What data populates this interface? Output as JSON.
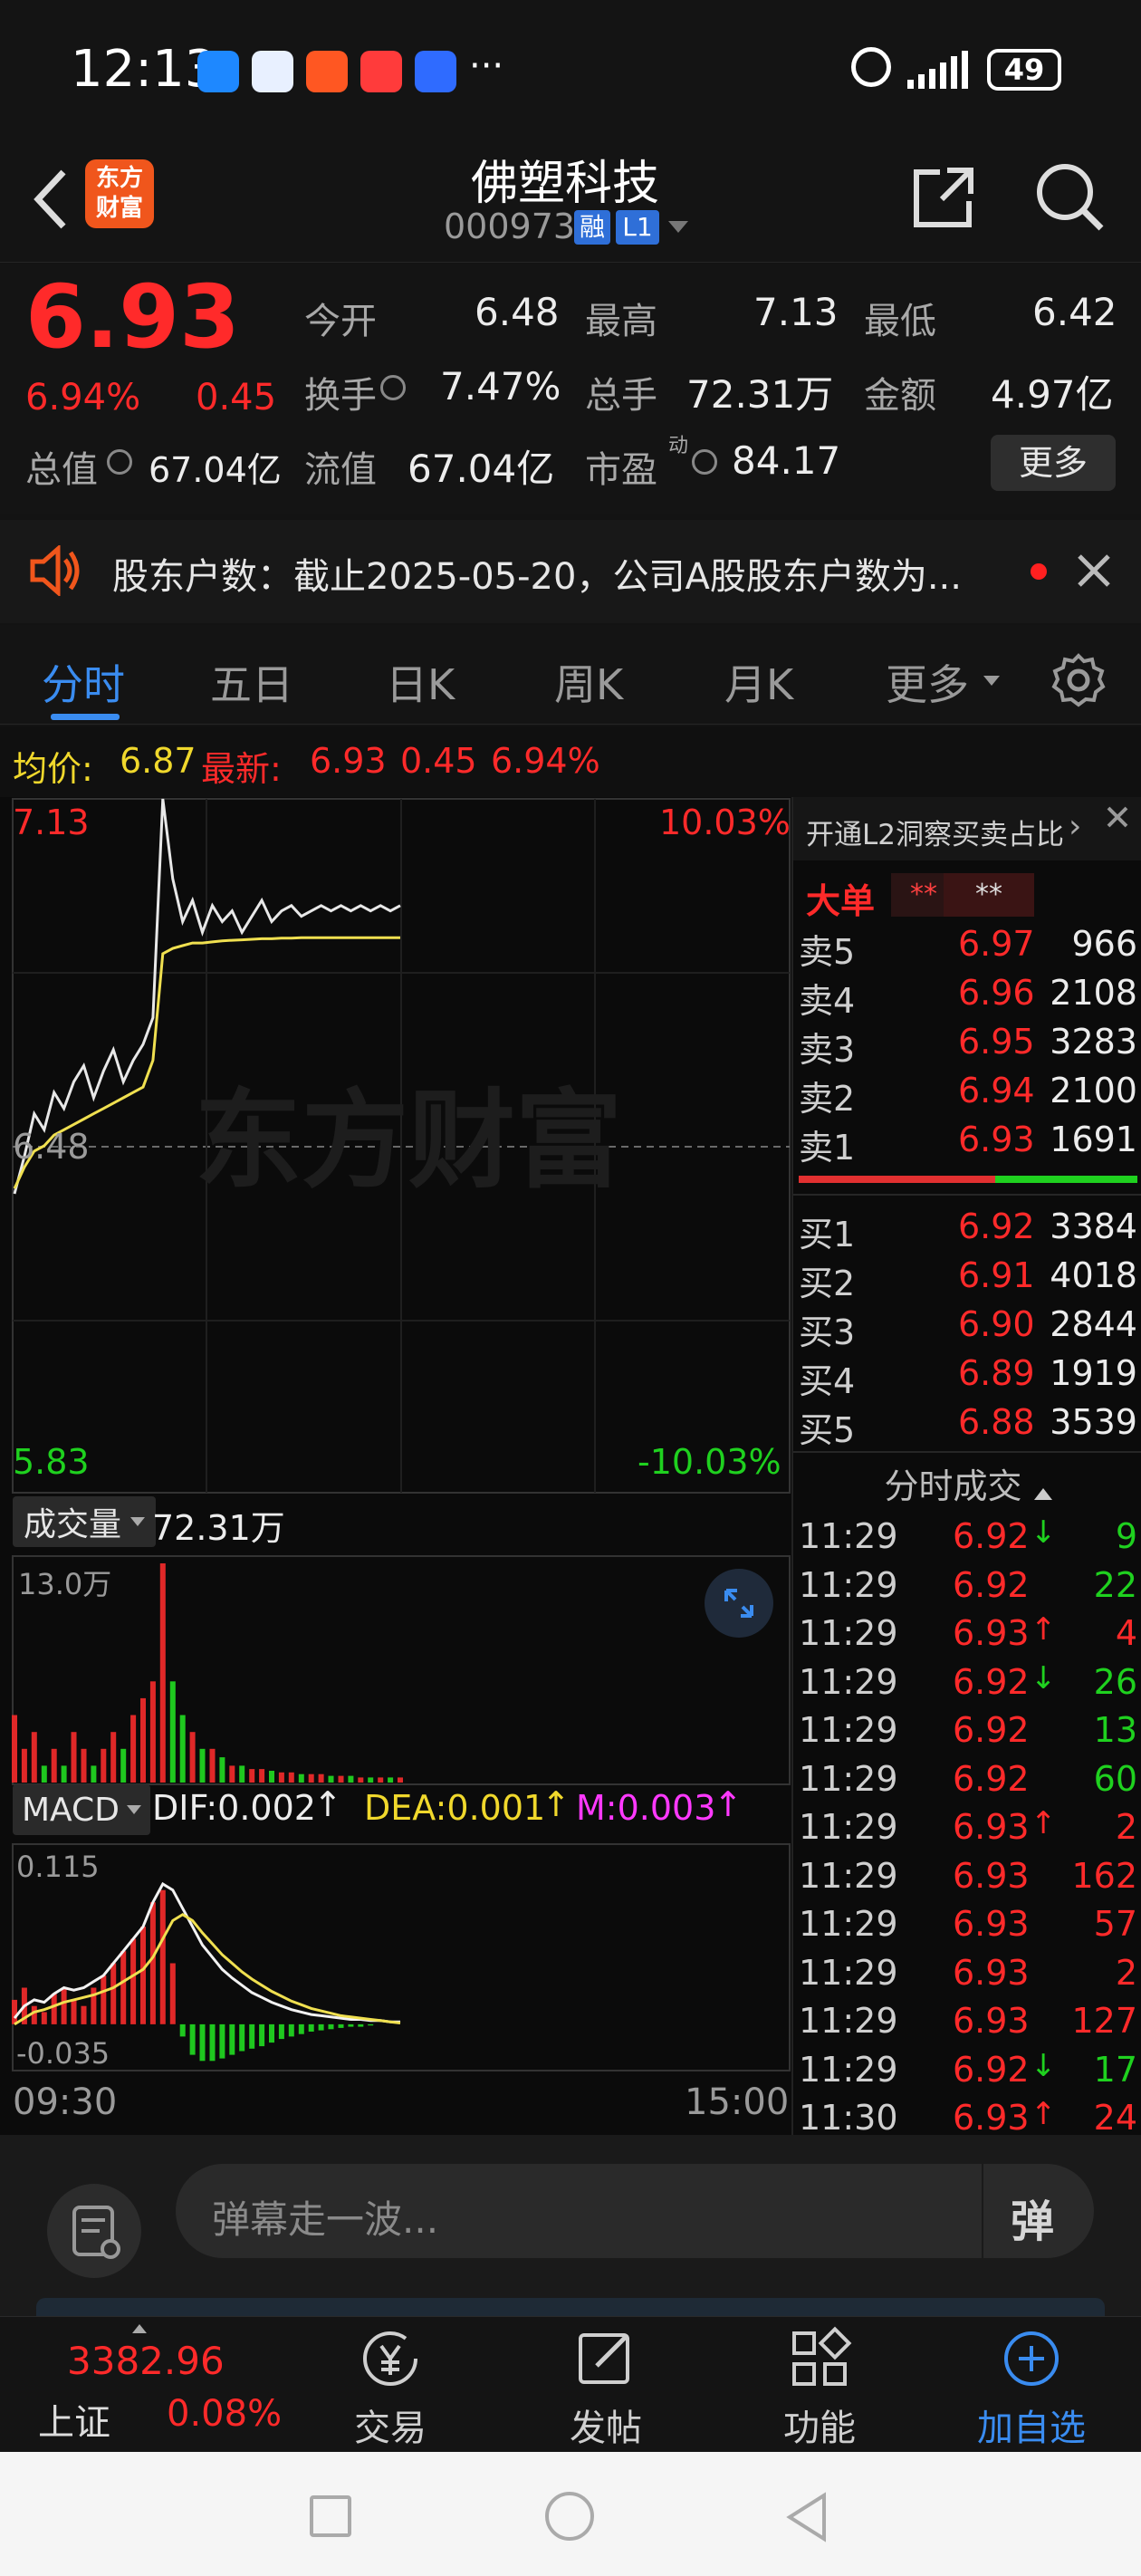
{
  "status_bar": {
    "time": "12:13",
    "more_dots": "···",
    "battery": "49"
  },
  "header": {
    "title": "佛塑科技",
    "code": "000973",
    "badge_margin": "融",
    "badge_level": "L1",
    "app_logo_line1": "东方",
    "app_logo_line2": "财富"
  },
  "quote": {
    "price": "6.93",
    "change_pct": "6.94%",
    "change_abs": "0.45",
    "open_label": "今开",
    "open": "6.48",
    "high_label": "最高",
    "high": "7.13",
    "low_label": "最低",
    "low": "6.42",
    "turnover_label": "换手",
    "turnover": "7.47%",
    "volume_label": "总手",
    "volume": "72.31万",
    "amount_label": "金额",
    "amount": "4.97亿",
    "total_mv_label": "总值",
    "total_mv": "67.04亿",
    "float_mv_label": "流值",
    "float_mv": "67.04亿",
    "pe_label": "市盈",
    "pe_sup": "动",
    "pe": "84.17",
    "more_button": "更多"
  },
  "notice": {
    "text": "股东户数：截止2025-05-20，公司A股股东户数为..."
  },
  "tabs": [
    "分时",
    "五日",
    "日K",
    "周K",
    "月K",
    "更多"
  ],
  "chart_header": {
    "avg_label": "均价:",
    "avg": "6.87",
    "latest_label": "最新:",
    "latest": "6.93",
    "chg": "0.45",
    "pct": "6.94%"
  },
  "chart_data": {
    "type": "line",
    "price_axis": {
      "top": "7.13",
      "mid": "6.48",
      "bottom": "5.83",
      "pct_top": "10.03%",
      "pct_bottom": "-10.03%"
    },
    "watermark": "东方财富",
    "volume_label": "成交量",
    "volume_total": "72.31万",
    "volume_max": "13.0万",
    "macd_label": "MACD",
    "dif": "DIF:0.002",
    "dea": "DEA:0.001",
    "m": "M:0.003",
    "macd_top": "0.115",
    "macd_bottom": "-0.035",
    "time_start": "09:30",
    "time_end": "15:00",
    "price_series": [
      6.39,
      6.46,
      6.54,
      6.51,
      6.58,
      6.55,
      6.6,
      6.63,
      6.57,
      6.62,
      6.66,
      6.6,
      6.64,
      6.67,
      6.72,
      7.13,
      6.98,
      6.9,
      6.94,
      6.88,
      6.93,
      6.9,
      6.92,
      6.88,
      6.91,
      6.94,
      6.9,
      6.92,
      6.93,
      6.91,
      6.92,
      6.93,
      6.92,
      6.93,
      6.92,
      6.93,
      6.92,
      6.93,
      6.92,
      6.93
    ],
    "avg_series": [
      6.4,
      6.44,
      6.47,
      6.48,
      6.5,
      6.51,
      6.52,
      6.53,
      6.54,
      6.55,
      6.56,
      6.57,
      6.58,
      6.59,
      6.64,
      6.84,
      6.85,
      6.855,
      6.86,
      6.86,
      6.862,
      6.864,
      6.865,
      6.866,
      6.867,
      6.868,
      6.868,
      6.869,
      6.869,
      6.87,
      6.87,
      6.87,
      6.87,
      6.87,
      6.87,
      6.87,
      6.87,
      6.87,
      6.87,
      6.87
    ],
    "volume": [
      4,
      2,
      3,
      1,
      2,
      1,
      3,
      2,
      1,
      2,
      3,
      2,
      4,
      5,
      6,
      13,
      6,
      4,
      3,
      2,
      2,
      1.5,
      1,
      1,
      0.8,
      0.8,
      0.7,
      0.6,
      0.6,
      0.5,
      0.5,
      0.5,
      0.4,
      0.4,
      0.4,
      0.3,
      0.3,
      0.3,
      0.3,
      0.3
    ],
    "macd_bar": [
      0.02,
      0.03,
      0.015,
      0.01,
      0.025,
      0.03,
      0.02,
      0.015,
      0.03,
      0.04,
      0.05,
      0.06,
      0.07,
      0.08,
      0.1,
      0.11,
      0.05,
      -0.01,
      -0.025,
      -0.03,
      -0.03,
      -0.028,
      -0.025,
      -0.022,
      -0.02,
      -0.018,
      -0.015,
      -0.012,
      -0.01,
      -0.008,
      -0.006,
      -0.005,
      -0.004,
      -0.003,
      -0.002,
      -0.002,
      -0.001,
      0,
      0,
      0
    ],
    "dif_series": [
      0.005,
      0.015,
      0.02,
      0.018,
      0.025,
      0.03,
      0.028,
      0.03,
      0.035,
      0.04,
      0.05,
      0.06,
      0.07,
      0.08,
      0.1,
      0.115,
      0.11,
      0.095,
      0.08,
      0.065,
      0.055,
      0.045,
      0.038,
      0.032,
      0.026,
      0.022,
      0.018,
      0.015,
      0.012,
      0.01,
      0.008,
      0.007,
      0.006,
      0.005,
      0.004,
      0.004,
      0.003,
      0.003,
      0.002,
      0.002
    ],
    "dea_series": [
      0.0,
      0.005,
      0.01,
      0.012,
      0.015,
      0.018,
      0.02,
      0.022,
      0.024,
      0.027,
      0.03,
      0.035,
      0.04,
      0.045,
      0.055,
      0.07,
      0.085,
      0.09,
      0.085,
      0.075,
      0.066,
      0.057,
      0.05,
      0.043,
      0.037,
      0.032,
      0.027,
      0.023,
      0.019,
      0.016,
      0.013,
      0.011,
      0.009,
      0.007,
      0.006,
      0.005,
      0.004,
      0.003,
      0.002,
      0.001
    ]
  },
  "order_book": {
    "promo": "开通L2洞察买卖占比",
    "big_order_label": "大单",
    "big_order_a": "**",
    "big_order_b": "**",
    "ask": [
      {
        "label": "卖5",
        "price": "6.97",
        "qty": "966"
      },
      {
        "label": "卖4",
        "price": "6.96",
        "qty": "2108"
      },
      {
        "label": "卖3",
        "price": "6.95",
        "qty": "3283"
      },
      {
        "label": "卖2",
        "price": "6.94",
        "qty": "2100"
      },
      {
        "label": "卖1",
        "price": "6.93",
        "qty": "1691"
      }
    ],
    "bid": [
      {
        "label": "买1",
        "price": "6.92",
        "qty": "3384"
      },
      {
        "label": "买2",
        "price": "6.91",
        "qty": "4018"
      },
      {
        "label": "买3",
        "price": "6.90",
        "qty": "2844"
      },
      {
        "label": "买4",
        "price": "6.89",
        "qty": "1919"
      },
      {
        "label": "买5",
        "price": "6.88",
        "qty": "3539"
      }
    ],
    "ratio_ask": 0.58
  },
  "trades": {
    "title": "分时成交",
    "rows": [
      {
        "time": "11:29",
        "price": "6.92",
        "arrow": "↓",
        "qty": "9",
        "side": "sell"
      },
      {
        "time": "11:29",
        "price": "6.92",
        "arrow": "",
        "qty": "22",
        "side": "sell"
      },
      {
        "time": "11:29",
        "price": "6.93",
        "arrow": "↑",
        "qty": "4",
        "side": "buy"
      },
      {
        "time": "11:29",
        "price": "6.92",
        "arrow": "↓",
        "qty": "26",
        "side": "sell"
      },
      {
        "time": "11:29",
        "price": "6.92",
        "arrow": "",
        "qty": "13",
        "side": "sell"
      },
      {
        "time": "11:29",
        "price": "6.92",
        "arrow": "",
        "qty": "60",
        "side": "sell"
      },
      {
        "time": "11:29",
        "price": "6.93",
        "arrow": "↑",
        "qty": "2",
        "side": "buy"
      },
      {
        "time": "11:29",
        "price": "6.93",
        "arrow": "",
        "qty": "162",
        "side": "buy"
      },
      {
        "time": "11:29",
        "price": "6.93",
        "arrow": "",
        "qty": "57",
        "side": "buy"
      },
      {
        "time": "11:29",
        "price": "6.93",
        "arrow": "",
        "qty": "2",
        "side": "buy"
      },
      {
        "time": "11:29",
        "price": "6.93",
        "arrow": "",
        "qty": "127",
        "side": "buy"
      },
      {
        "time": "11:29",
        "price": "6.92",
        "arrow": "↓",
        "qty": "17",
        "side": "sell"
      },
      {
        "time": "11:30",
        "price": "6.93",
        "arrow": "↑",
        "qty": "24",
        "side": "buy"
      }
    ]
  },
  "comment": {
    "placeholder": "弹幕走一波...",
    "danmu_button": "弹"
  },
  "tabbar": {
    "index_value": "3382.96",
    "index_name": "上证",
    "index_pct": "0.08%",
    "trade": "交易",
    "post": "发帖",
    "func": "功能",
    "watch": "加自选"
  },
  "colors": {
    "up": "#ff2a2a",
    "down": "#1fd11f",
    "accent": "#3a8cf0",
    "avg_line": "#f0e050"
  }
}
